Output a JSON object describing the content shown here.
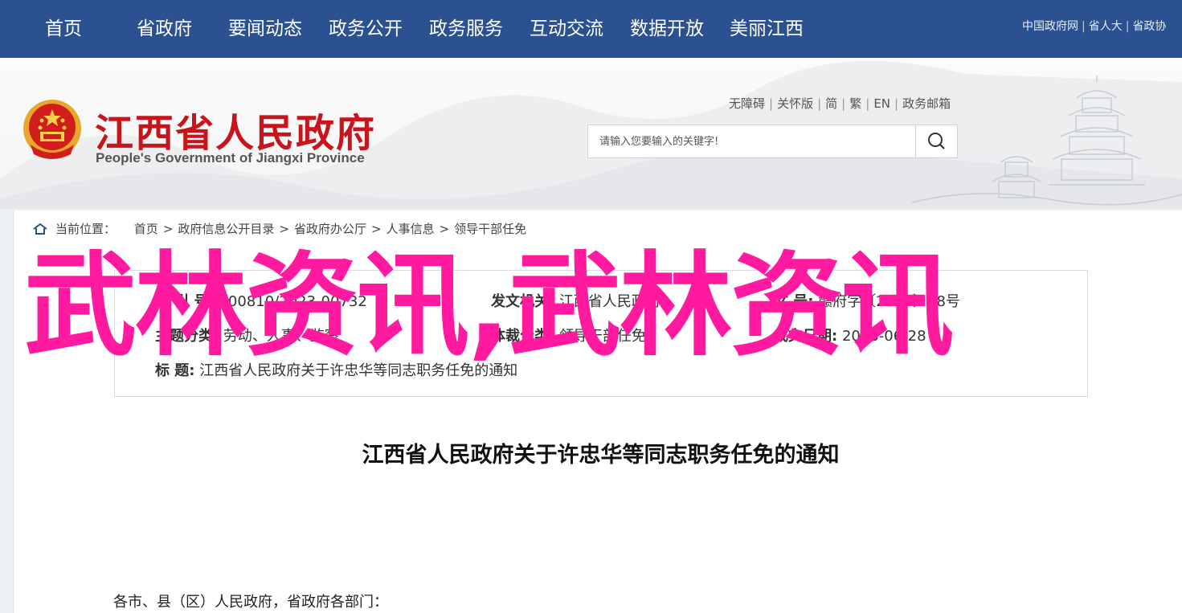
{
  "topnav": {
    "items": [
      "首页",
      "省政府",
      "要闻动态",
      "政务公开",
      "政务服务",
      "互动交流",
      "数据开放",
      "美丽江西"
    ],
    "links": [
      "中国政府网",
      "省人大",
      "省政协"
    ]
  },
  "header": {
    "title_cn": "江西省人民政府",
    "title_en": "People's Government of Jiangxi Province",
    "util_links": [
      "无障碍",
      "关怀版",
      "简",
      "繁",
      "EN",
      "政务邮箱"
    ],
    "search_placeholder": "请输入您要输入的关键字!"
  },
  "breadcrumb": {
    "prefix": "当前位置：",
    "items": [
      "首页",
      "政府信息公开目录",
      "省政府办公厅",
      "人事信息",
      "领导干部任免"
    ]
  },
  "meta": {
    "index_label": "索 引 号:",
    "index_value": "000810/2023-00732",
    "issuer_label": "发文机关:",
    "issuer_value": "江西省人民政府",
    "docno_label": "文 号:",
    "docno_value": "赣府字〔2023〕38号",
    "topic_label": "主题分类:",
    "topic_value": "劳动、人事、监察",
    "genre_label": "体裁分类:",
    "genre_value": "领导干部任免",
    "date_label": "成文日期:",
    "date_value": "2023-06-28",
    "title_label": "标 题:",
    "title_value": "江西省人民政府关于许忠华等同志职务任免的通知"
  },
  "watermark": "武林资讯,武林资讯",
  "document": {
    "title": "江西省人民政府关于许忠华等同志职务任免的通知",
    "greeting": "各市、县（区）人民政府，省政府各部门："
  },
  "colors": {
    "nav_bg": "#2b5190",
    "title_red": "#c8151c",
    "watermark": "#ff1aa0"
  }
}
